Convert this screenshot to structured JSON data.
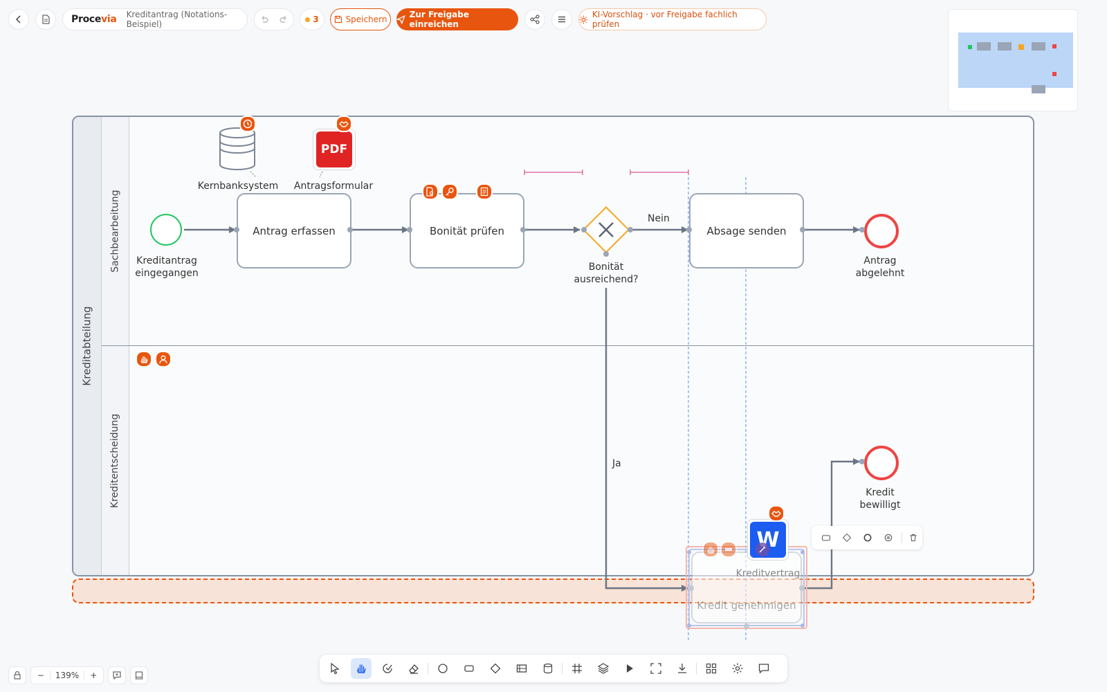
{
  "app": {
    "brand_main": "Proce",
    "brand_accent": "via",
    "doc_title": "Kreditantrag (Notations-Beispiel)"
  },
  "toolbar_top": {
    "change_count": "3",
    "save_label": "Speichern",
    "submit_label": "Zur Freigabe einreichen",
    "ai_hint": "KI-Vorschlag · vor Freigabe fachlich prüfen"
  },
  "pool": {
    "name": "Kreditabteilung",
    "lanes": [
      "Sachbearbeitung",
      "Kreditentscheidung"
    ]
  },
  "diagram": {
    "start_event": "Kreditantrag eingegangen",
    "data_store": "Kernbanksystem",
    "data_object": "Antragsformular",
    "data_object_icon_text": "PDF",
    "task_1": "Antrag erfassen",
    "task_2": "Bonität prüfen",
    "gateway": "Bonität ausreichend?",
    "flow_no": "Nein",
    "flow_yes": "Ja",
    "task_3": "Absage senden",
    "end_rejected": "Antrag abgelehnt",
    "end_approved": "Kredit bewilligt",
    "task_4": "Kredit genehmigen",
    "artifact_4": "Kreditvertrag",
    "artifact_4_icon_text": "W"
  },
  "zoom": {
    "level": "139%"
  },
  "colors": {
    "accent": "#e8550f",
    "start": "#22c55e",
    "end": "#ef4444",
    "gateway": "#f5a623",
    "word_blue": "#1d5cf0",
    "pdf_red": "#e02424"
  },
  "icons": {
    "back": "chevron-left-icon",
    "document": "document-icon",
    "undo": "undo-icon",
    "redo": "redo-icon",
    "share": "share-icon",
    "menu": "menu-icon",
    "ai": "sparkle-icon"
  }
}
